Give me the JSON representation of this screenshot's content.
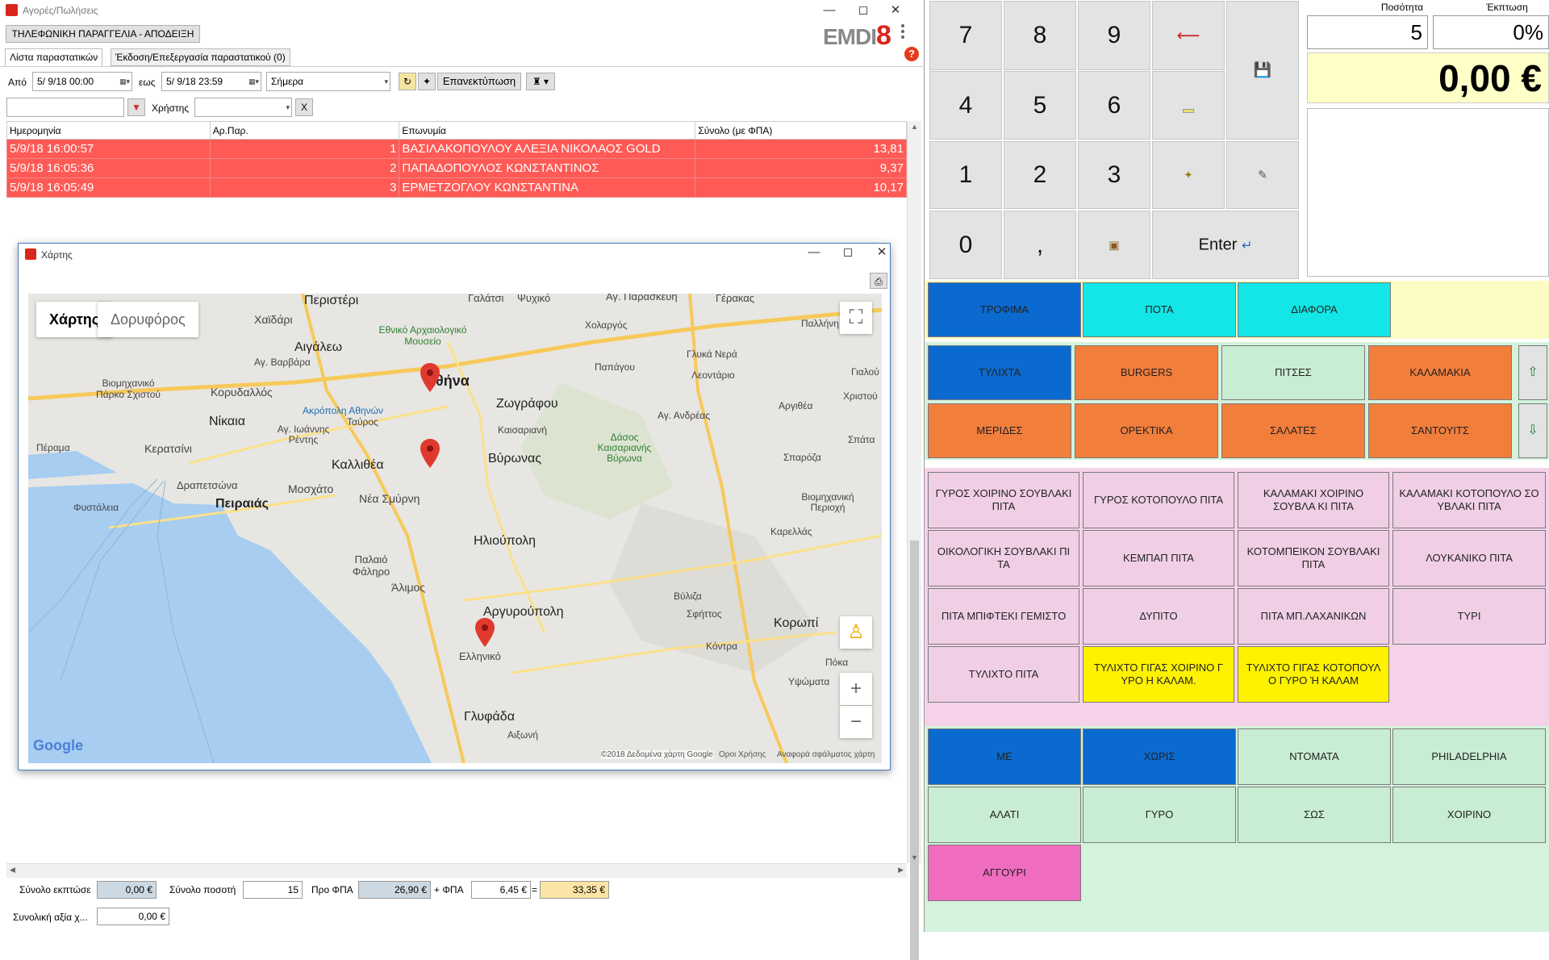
{
  "window": {
    "title": "Αγορές/Πωλήσεις",
    "doc_type": "ΤΗΛΕΦΩΝΙΚΗ ΠΑΡΑΓΓΕΛΙΑ - ΑΠΟΔΕΙΞΗ",
    "logo": "EMDI8",
    "tabs": [
      "Λίστα παραστατικών",
      "Έκδοση/Επεξεργασία παραστατικού (0)"
    ]
  },
  "filters": {
    "from_label": "Από",
    "from_value": "5/ 9/18 00:00",
    "to_label": "εως",
    "to_value": "5/ 9/18 23:59",
    "period_value": "Σήμερα",
    "reprint_label": "Επανεκτύπωση",
    "user_label": "Χρήστης",
    "clear_label": "X"
  },
  "grid": {
    "columns": [
      "Ημερομηνία",
      "Αρ.Παρ.",
      "Επωνυμία",
      "Σύνολο (με ΦΠΑ)"
    ],
    "rows": [
      {
        "date": "5/9/18 16:00:57",
        "num": "1",
        "name": "ΒΑΣΙΛΑΚΟΠΟΥΛΟΥ ΑΛΕΞΙΑ ΝΙΚΟΛΑΟΣ   GOLD",
        "total": "13,81"
      },
      {
        "date": "5/9/18 16:05:36",
        "num": "2",
        "name": "ΠΑΠΑΔΟΠΟΥΛΟΣ ΚΩΝΣΤΑΝΤΙΝΟΣ",
        "total": "9,37"
      },
      {
        "date": "5/9/18 16:05:49",
        "num": "3",
        "name": "ΕΡΜΕΤΖΟΓΛΟΥ ΚΩΝΣΤΑΝΤΙΝΑ",
        "total": "10,17"
      }
    ]
  },
  "map_window": {
    "title": "Χάρτης",
    "tab_map": "Χάρτης",
    "tab_satellite": "Δορυφόρος",
    "google": "Google",
    "copyright": "©2018 Δεδομένα χάρτη Google",
    "terms": "Οροι Χρήσης",
    "report": "Αναφορά σφάλματος χάρτη",
    "places": [
      "Περιστέρι",
      "Γαλάτσι",
      "Ψυχικό",
      "Αγ. Παρασκευή",
      "Γέρακας",
      "Χαϊδάρι",
      "Εθνικό Αρχαιολογικό Μουσείο",
      "Χολαργός",
      "Παλλήνη",
      "Αιγάλεω",
      "Αγ. Βαρβάρα",
      "Γλυκά Νερά",
      "Παπάγου",
      "Αθήνα",
      "Λεοντάριο",
      "Γιαλού",
      "Βιομηχανικό Πάρκο Σχιστού",
      "Κορυδαλλός",
      "Ακρόπολη Αθηνών",
      "Ζωγράφου",
      "Αργιθέα",
      "Χριστού",
      "Νίκαια",
      "Αγ. Ιωάννης Ρέντης",
      "Ταύρος",
      "Καισαριανή",
      "Αγ. Ανδρέας",
      "Πέραμα",
      "Κερατσίνι",
      "Καλλιθέα",
      "Βύρωνας",
      "Δάσος Καισαριανής Βύρωνα",
      "Σπάτα",
      "Σπαρόζα",
      "Δραπετσώνα",
      "Μοσχάτο",
      "Φυστάλεια",
      "Πειραιάς",
      "Νέα Σμύρνη",
      "Βιομηχανική Περιοχή",
      "Καρελλάς",
      "Ηλιούπολη",
      "Παλαιό Φάληρο",
      "Άλιμος",
      "Βύλιζα",
      "Αργυρούπολη",
      "Σφήττος",
      "Κορωπί",
      "Κόντρα",
      "Ελληνικό",
      "Πόκα",
      "Υψώματα",
      "Γλυφάδα",
      "Αιξωνή"
    ]
  },
  "footer": {
    "discount_label": "Σύνολο εκπτώσε",
    "discount_value": "0,00 €",
    "qty_label": "Σύνολο ποσοτή",
    "qty_value": "15",
    "prevat_label": "Προ ΦΠΑ",
    "prevat_value": "26,90 €",
    "vat_label": "+ ΦΠΑ",
    "vat_value": "6,45 €",
    "eq_label": "=",
    "total_value": "33,35 €",
    "grand_label": "Συνολική αξία χ...",
    "grand_value": "0,00 €"
  },
  "keypad": {
    "keys": [
      "7",
      "8",
      "9",
      "4",
      "5",
      "6",
      "1",
      "2",
      "3",
      "0",
      ","
    ],
    "enter_label": "Enter"
  },
  "qty_panel": {
    "qty_label": "Ποσότητα",
    "qty_value": "5",
    "disc_label": "Έκπτωση",
    "disc_value": "0%",
    "total": "0,00 €"
  },
  "groups": [
    "ΤΡΟΦΙΜΑ",
    "ΠΟΤΑ",
    "ΔΙΑΦΟΡΑ"
  ],
  "subgroups": [
    "ΤΥΛΙΧΤΑ",
    "BURGERS",
    "ΠΙΤΣΕΣ",
    "ΚΑΛΑΜΑΚΙΑ",
    "ΜΕΡΙΔΕΣ",
    "ΟΡΕΚΤΙΚΑ",
    "ΣΑΛΑΤΕΣ",
    "ΣΑΝΤΟΥΙΤΣ"
  ],
  "products": [
    "ΓΥΡΟΣ ΧΟΙΡΙΝΟ ΣΟΥΒΛΑΚΙ ΠΙΤΑ",
    "ΓΥΡΟΣ ΚΟΤΟΠΟΥΛΟ ΠΙΤΑ",
    "ΚΑΛΑΜΑΚΙ ΧΟΙΡΙΝΟ ΣΟΥΒΛΑ ΚΙ ΠΙΤΑ",
    "ΚΑΛΑΜΑΚΙ ΚΟΤΟΠΟΥΛΟ ΣΟ ΥΒΛΑΚΙ ΠΙΤΑ",
    "ΟΙΚΟΛΟΓΙΚΗ ΣΟΥΒΛΑΚΙ ΠΙ ΤΑ",
    "ΚΕΜΠΑΠ ΠΙΤΑ",
    "ΚΟΤΟΜΠΕΙΚΟΝ ΣΟΥΒΛΑΚΙ ΠΙΤΑ",
    "ΛΟΥΚΑΝΙΚΟ ΠΙΤΑ",
    "ΠΙΤΑ ΜΠΙΦΤΕΚΙ ΓΕΜΙΣΤΟ",
    "ΔΥΠΙΤΟ",
    "ΠΙΤΑ ΜΠ.ΛΑΧΑΝΙΚΩΝ",
    "ΤΥΡΙ",
    "ΤΥΛΙΧΤΟ ΠΙΤΑ",
    "ΤΥΛΙΧΤΟ ΓΙΓΑΣ ΧΟΙΡΙΝΟ Γ ΥΡΟ Η ΚΑΛΑΜ.",
    "ΤΥΛΙΧΤΟ ΓΙΓΑΣ ΚΟΤΟΠΟΥΛ Ο ΓΥΡΟ Ή ΚΑΛΑΜ"
  ],
  "extras": [
    "ΜΕ",
    "ΧΩΡΙΣ",
    "ΝΤΟΜΑΤΑ",
    "PHILADELPHIA",
    "ΑΛΑΤΙ",
    "ΓΥΡΟ",
    "ΣΩΣ",
    "ΧΟΙΡΙΝΟ",
    "ΑΓΓΟΥΡΙ"
  ]
}
